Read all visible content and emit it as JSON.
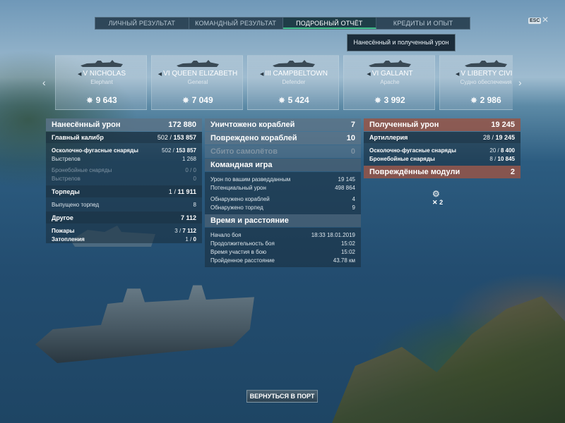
{
  "tabs": [
    {
      "label": "ЛИЧНЫЙ РЕЗУЛЬТАТ",
      "active": false
    },
    {
      "label": "КОМАНДНЫЙ РЕЗУЛЬТАТ",
      "active": false
    },
    {
      "label": "ПОДРОБНЫЙ ОТЧЁТ",
      "active": true
    },
    {
      "label": "КРЕДИТЫ И ОПЫТ",
      "active": false
    }
  ],
  "esc_label": "ESC",
  "tooltip": "Нанесённый и полученный урон",
  "ships": [
    {
      "cls": "V",
      "name": "NICHOLAS",
      "subname": "Elephant",
      "damage": "9 643",
      "type_icon": "destroyer-icon"
    },
    {
      "cls": "VI",
      "name": "QUEEN ELIZABETH",
      "subname": "General",
      "damage": "7 049",
      "type_icon": "battleship-icon"
    },
    {
      "cls": "III",
      "name": "CAMPBELTOWN",
      "subname": "Defender",
      "damage": "5 424",
      "type_icon": "destroyer-icon"
    },
    {
      "cls": "VI",
      "name": "GALLANT",
      "subname": "Apache",
      "damage": "3 992",
      "type_icon": "destroyer-icon"
    },
    {
      "cls": "V",
      "name": "LIBERTY CIVIL",
      "subname": "Судно обеспечения",
      "damage": "2 986",
      "type_icon": "transport-icon"
    }
  ],
  "dealt": {
    "title": "Нанесённый урон",
    "total": "172 880",
    "main_battery": {
      "label": "Главный калибр",
      "value": "502",
      "total": "153 857"
    },
    "he": {
      "label": "Осколочно-фугасные снаряды",
      "value": "502",
      "total": "153 857"
    },
    "he_shots": {
      "label": "Выстрелов",
      "value": "1 268"
    },
    "ap": {
      "label": "Бронебойные снаряды",
      "value": "0",
      "total": "0"
    },
    "ap_shots": {
      "label": "Выстрелов",
      "value": "0"
    },
    "torpedoes": {
      "label": "Торпеды",
      "value": "1",
      "total": "11 911"
    },
    "torp_fired": {
      "label": "Выпущено торпед",
      "value": "8"
    },
    "other": {
      "label": "Другое",
      "value": "7 112"
    },
    "fires": {
      "label": "Пожары",
      "value": "3",
      "total": "7 112"
    },
    "floods": {
      "label": "Затопления",
      "value": "1",
      "total": "0"
    }
  },
  "mid": {
    "destroyed": {
      "label": "Уничтожено кораблей",
      "value": "7"
    },
    "damaged": {
      "label": "Повреждено кораблей",
      "value": "10"
    },
    "planes": {
      "label": "Сбито самолётов",
      "value": "0"
    },
    "team_title": "Командная игра",
    "spotted_damage": {
      "label": "Урон по вашим разведданным",
      "value": "19 145"
    },
    "potential": {
      "label": "Потенциальный урон",
      "value": "498 864"
    },
    "spotted_ships": {
      "label": "Обнаружено кораблей",
      "value": "4"
    },
    "spotted_torps": {
      "label": "Обнаружено торпед",
      "value": "9"
    },
    "time_title": "Время и расстояние",
    "start": {
      "label": "Начало боя",
      "value": "18:33  18.01.2019"
    },
    "duration": {
      "label": "Продолжительность боя",
      "value": "15:02"
    },
    "participation": {
      "label": "Время участия в бою",
      "value": "15:02"
    },
    "distance": {
      "label": "Пройденное расстояние",
      "value": "43.78 км"
    }
  },
  "received": {
    "title": "Полученный урон",
    "total": "19 245",
    "artillery": {
      "label": "Артиллерия",
      "value": "28",
      "total": "19 245"
    },
    "he": {
      "label": "Осколочно-фугасные снаряды",
      "value": "20",
      "total": "8 400"
    },
    "ap": {
      "label": "Бронебойные снаряды",
      "value": "8",
      "total": "10 845"
    },
    "modules": {
      "label": "Повреждённые модули",
      "value": "2"
    },
    "module_icon_count": "2"
  },
  "return_button": "ВЕРНУТЬСЯ В ПОРТ",
  "colors": {
    "accent": "#3ec08a",
    "header": "#5a7387",
    "received_header": "#96554b"
  }
}
